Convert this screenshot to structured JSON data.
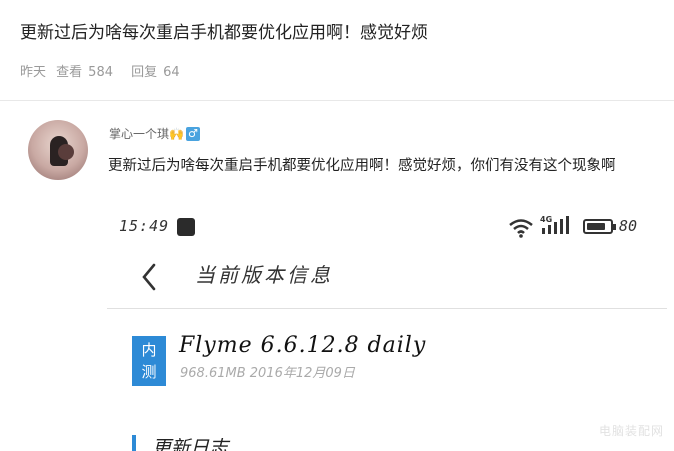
{
  "thread": {
    "title": "更新过后为啥每次重启手机都要优化应用啊！感觉好烦",
    "meta": {
      "time": "昨天",
      "views_label": "查看",
      "views": "584",
      "replies_label": "回复",
      "replies": "64"
    }
  },
  "post": {
    "username": "掌心一个琪🙌",
    "gender_icon": "male-icon",
    "gender_glyph": "♂",
    "text": "更新过后为啥每次重启手机都要优化应用啊！感觉好烦，你们有没有这个现象啊"
  },
  "screenshot": {
    "status_bar": {
      "time": "15:49",
      "network": "4G",
      "battery": "80",
      "battery_level": 0.8
    },
    "page_title": "当前版本信息",
    "badge": "内测",
    "version": "Flyme 6.6.12.8 daily",
    "version_meta": "968.61MB 2016年12月09日",
    "changelog_title": "更新日志"
  },
  "watermark": "电脑装配网",
  "colors": {
    "accent": "#2d8ad6",
    "gender_badge": "#4aa3df"
  }
}
